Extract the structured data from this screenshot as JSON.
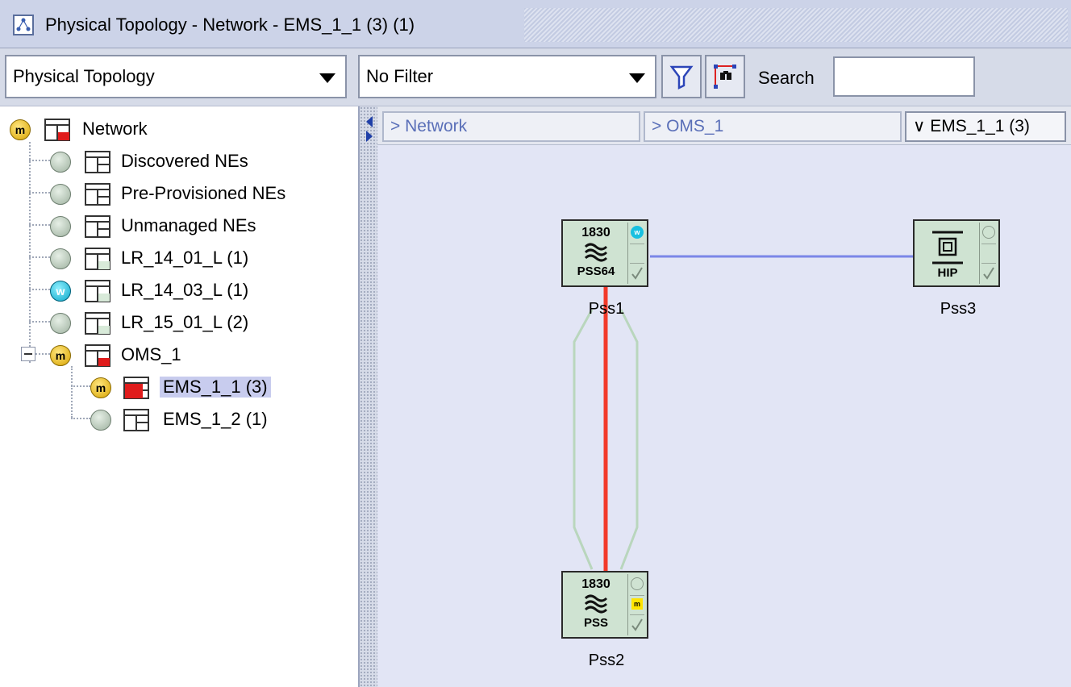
{
  "window": {
    "title": "Physical Topology - Network - EMS_1_1 (3) (1)"
  },
  "toolbar": {
    "view_select": "Physical Topology",
    "filter_select": "No Filter",
    "search_label": "Search",
    "search_value": ""
  },
  "tree": {
    "items": [
      {
        "label": "Network",
        "status": "m",
        "status_text": "m"
      },
      {
        "label": "Discovered NEs",
        "status": "grey",
        "status_text": ""
      },
      {
        "label": "Pre-Provisioned NEs",
        "status": "grey",
        "status_text": ""
      },
      {
        "label": "Unmanaged NEs",
        "status": "grey",
        "status_text": ""
      },
      {
        "label": "LR_14_01_L (1)",
        "status": "grey",
        "status_text": ""
      },
      {
        "label": "LR_14_03_L (1)",
        "status": "w",
        "status_text": "w"
      },
      {
        "label": "LR_15_01_L (2)",
        "status": "grey",
        "status_text": ""
      },
      {
        "label": "OMS_1",
        "status": "m",
        "status_text": "m"
      },
      {
        "label": "EMS_1_1 (3)",
        "status": "m",
        "status_text": "m",
        "selected": true
      },
      {
        "label": "EMS_1_2 (1)",
        "status": "grey",
        "status_text": ""
      }
    ]
  },
  "breadcrumb": {
    "items": [
      "> Network",
      "> OMS_1",
      "∨ EMS_1_1 (3)"
    ]
  },
  "map": {
    "nodes": [
      {
        "name": "Pss1",
        "model_top": "1830",
        "model_bottom": "PSS64",
        "alarm": "w"
      },
      {
        "name": "Pss3",
        "model_top": "",
        "model_bottom": "HIP",
        "alarm": ""
      },
      {
        "name": "Pss2",
        "model_top": "1830",
        "model_bottom": "PSS",
        "alarm": "m"
      }
    ],
    "colors": {
      "link_blue": "#7b86e8",
      "link_red": "#f23a2a",
      "link_green": "#b9d6bd"
    }
  }
}
